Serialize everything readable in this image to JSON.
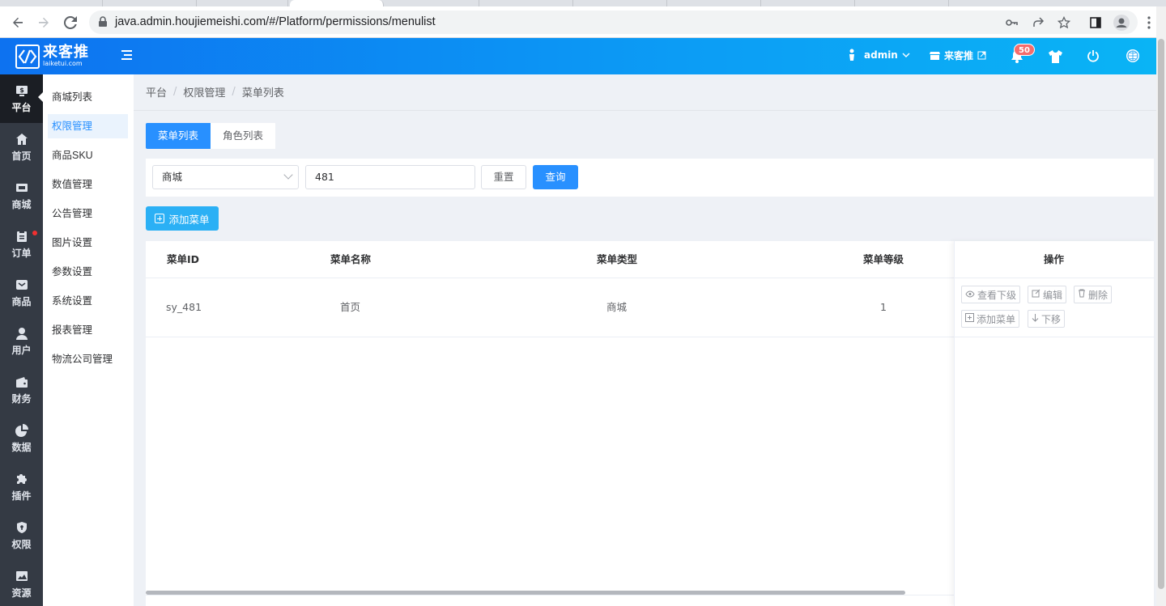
{
  "browser": {
    "url": "java.admin.houjiemeishi.com/#/Platform/permissions/menulist"
  },
  "header": {
    "logo_title": "来客推",
    "logo_sub": "laiketui.com",
    "user": "admin",
    "shop": "来客推",
    "notif_count": "50"
  },
  "iconbar": {
    "items": [
      {
        "label": "平台",
        "icon": "store-icon"
      },
      {
        "label": "首页",
        "icon": "home-icon"
      },
      {
        "label": "商城",
        "icon": "mall-icon"
      },
      {
        "label": "订单",
        "icon": "order-icon"
      },
      {
        "label": "商品",
        "icon": "product-icon"
      },
      {
        "label": "用户",
        "icon": "user-icon"
      },
      {
        "label": "财务",
        "icon": "wallet-icon"
      },
      {
        "label": "数据",
        "icon": "pie-chart-icon"
      },
      {
        "label": "插件",
        "icon": "puzzle-icon"
      },
      {
        "label": "权限",
        "icon": "shield-icon"
      },
      {
        "label": "资源",
        "icon": "image-icon"
      }
    ]
  },
  "submenu": {
    "items": [
      "商城列表",
      "权限管理",
      "商品SKU",
      "数值管理",
      "公告管理",
      "图片设置",
      "参数设置",
      "系统设置",
      "报表管理",
      "物流公司管理"
    ]
  },
  "breadcrumb": [
    "平台",
    "权限管理",
    "菜单列表"
  ],
  "tabs": [
    "菜单列表",
    "角色列表"
  ],
  "filter": {
    "select_value": "商城",
    "input_value": "481",
    "reset_label": "重置",
    "query_label": "查询"
  },
  "add_button": "添加菜单",
  "table": {
    "headers": [
      "菜单ID",
      "菜单名称",
      "菜单类型",
      "菜单等级",
      "操作"
    ],
    "rows": [
      {
        "id": "sy_481",
        "name": "首页",
        "type": "商城",
        "level": "1"
      }
    ],
    "ops": [
      "查看下级",
      "编辑",
      "删除",
      "添加菜单",
      "下移"
    ]
  },
  "colors": {
    "primary": "#2890ff",
    "header_start": "#0d72f0",
    "header_end": "#0ab4f5",
    "iconbar": "#343a44"
  }
}
